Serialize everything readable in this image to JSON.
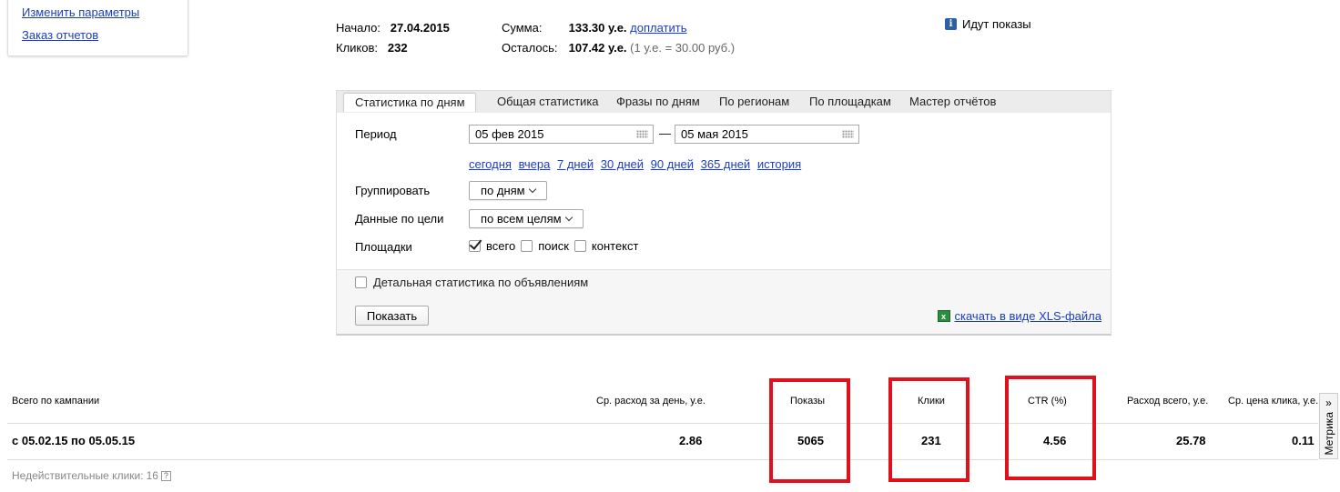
{
  "sidebar": {
    "links": [
      "Изменить параметры",
      "Заказ отчетов"
    ]
  },
  "summary": {
    "start_label": "Начало:",
    "start_value": "27.04.2015",
    "clicks_label": "Кликов:",
    "clicks_value": "232",
    "sum_label": "Сумма:",
    "sum_value": "133.30 у.е.",
    "topup_link": "доплатить",
    "remain_label": "Осталось:",
    "remain_value": "107.42 у.е.",
    "rate_note": "(1 у.е. = 30.00 руб.)"
  },
  "status": {
    "text": "Идут показы",
    "icon": "info-icon"
  },
  "tabs": [
    "Статистика по дням",
    "Общая статистика",
    "Фразы по дням",
    "По регионам",
    "По площадкам",
    "Мастер отчётов"
  ],
  "form": {
    "period_label": "Период",
    "date_from": "05 фев 2015",
    "date_to": "05 мая 2015",
    "dash": "—",
    "quick_ranges": [
      "сегодня",
      "вчера",
      "7 дней",
      "30 дней",
      "90 дней",
      "365 дней",
      "история"
    ],
    "group_label": "Группировать",
    "group_value": "по дням",
    "goal_label": "Данные по цели",
    "goal_value": "по всем целям",
    "platforms_label": "Площадки",
    "platform_all": "всего",
    "platform_search": "поиск",
    "platform_context": "контекст",
    "detail_label": "Детальная статистика по объявлениям",
    "show_button": "Показать",
    "xls_link": "скачать в виде XLS-файла"
  },
  "table": {
    "headers": {
      "campaign": "Всего по кампании",
      "avg_daily": "Ср. расход за день, у.е.",
      "impressions": "Показы",
      "clicks": "Клики",
      "ctr": "CTR (%)",
      "total_spend": "Расход всего, у.е.",
      "avg_cpc": "Ср. цена клика, у.е."
    },
    "row": {
      "range": "с 05.02.15 по 05.05.15",
      "avg_daily": "2.86",
      "impressions": "5065",
      "clicks": "231",
      "ctr": "4.56",
      "total_spend": "25.78",
      "avg_cpc": "0.11"
    },
    "invalid_clicks_label": "Недействительные клики:",
    "invalid_clicks_value": "16",
    "help_glyph": "?"
  },
  "metrika": {
    "arrow": "»",
    "label": "Метрика"
  },
  "colors": {
    "link": "#1a3dc1",
    "highlight": "#e0111b"
  }
}
